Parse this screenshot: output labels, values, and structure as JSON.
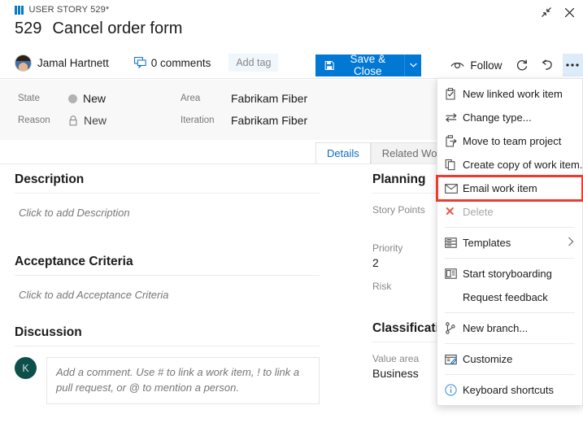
{
  "window": {
    "collapse_icon": "collapse-arrows-icon",
    "close_icon": "close-x-icon"
  },
  "header": {
    "breadcrumb": "USER STORY 529*",
    "work_item_id": "529",
    "title": "Cancel order form",
    "author": "Jamal Hartnett",
    "comments_label": "0 comments",
    "add_tag_label": "Add tag",
    "save_label": "Save & Close",
    "save_dropdown_icon": "chevron-down-icon",
    "follow_label": "Follow",
    "refresh_icon": "refresh-icon",
    "undo_icon": "undo-icon",
    "more_actions_icon": "ellipsis-icon"
  },
  "fields": [
    {
      "label": "State",
      "value": "New",
      "icon": "state-dot-icon"
    },
    {
      "label": "Reason",
      "value": "New",
      "icon": "lock-icon"
    },
    {
      "label": "Area",
      "value": "Fabrikam Fiber",
      "icon": ""
    },
    {
      "label": "Iteration",
      "value": "Fabrikam Fiber",
      "icon": ""
    }
  ],
  "tabs": [
    {
      "label": "Details",
      "selected": true
    },
    {
      "label": "Related Work it",
      "selected": false
    }
  ],
  "main": {
    "description_title": "Description",
    "description_placeholder": "Click to add Description",
    "acceptance_title": "Acceptance Criteria",
    "acceptance_placeholder": "Click to add Acceptance Criteria",
    "discussion_title": "Discussion",
    "discussion_avatar_initial": "K",
    "discussion_placeholder": "Add a comment. Use # to link a work item, ! to link a pull request, or @ to mention a person."
  },
  "planning": {
    "title": "Planning",
    "story_points_label": "Story Points",
    "story_points_value": "",
    "priority_label": "Priority",
    "priority_value": "2",
    "risk_label": "Risk",
    "risk_value": ""
  },
  "classification": {
    "title": "Classificati",
    "value_area_label": "Value area",
    "value_area_value": "Business"
  },
  "context_menu": {
    "items": [
      {
        "label": "New linked work item",
        "icon": "new-linked-work-item-icon",
        "disabled": false,
        "submenu": false,
        "highlighted": false
      },
      {
        "label": "Change type...",
        "icon": "change-type-icon",
        "disabled": false,
        "submenu": false,
        "highlighted": false
      },
      {
        "label": "Move to team project",
        "icon": "move-to-team-project-icon",
        "disabled": false,
        "submenu": false,
        "highlighted": false
      },
      {
        "label": "Create copy of work item...",
        "icon": "copy-icon",
        "disabled": false,
        "submenu": false,
        "highlighted": false
      },
      {
        "label": "Email work item",
        "icon": "email-icon",
        "disabled": false,
        "submenu": false,
        "highlighted": true
      },
      {
        "label": "Delete",
        "icon": "delete-x-icon",
        "disabled": true,
        "submenu": false,
        "highlighted": false
      },
      {
        "label": "Templates",
        "icon": "templates-icon",
        "disabled": false,
        "submenu": true,
        "highlighted": false
      },
      {
        "label": "Start storyboarding",
        "icon": "storyboard-icon",
        "disabled": false,
        "submenu": false,
        "highlighted": false
      },
      {
        "label": "Request feedback",
        "icon": "",
        "disabled": false,
        "submenu": false,
        "highlighted": false
      },
      {
        "label": "New branch...",
        "icon": "branch-icon",
        "disabled": false,
        "submenu": false,
        "highlighted": false
      },
      {
        "label": "Customize",
        "icon": "customize-icon",
        "disabled": false,
        "submenu": false,
        "highlighted": false
      },
      {
        "label": "Keyboard shortcuts",
        "icon": "info-icon",
        "disabled": false,
        "submenu": false,
        "highlighted": false
      }
    ]
  },
  "colors": {
    "accent_bar": "#0a9ed9",
    "primary_button": "#0078d4",
    "tab_selected_text": "#0b6fc4",
    "highlight_outline": "#ef3b2d",
    "avatar_discussion": "#0d4f4b"
  }
}
